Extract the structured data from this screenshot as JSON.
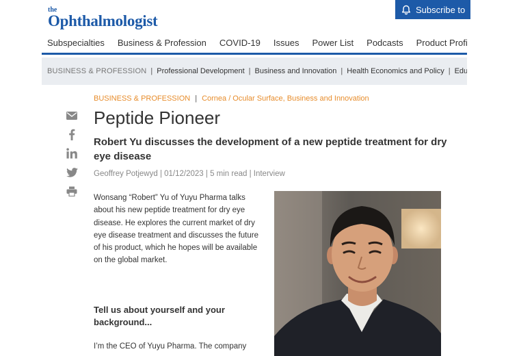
{
  "header": {
    "logo_the": "the",
    "logo_name": "Ophthalmologist",
    "subscribe_label": "Subscribe to"
  },
  "main_nav": {
    "items": [
      "Subspecialties",
      "Business & Profession",
      "COVID-19",
      "Issues",
      "Power List",
      "Podcasts",
      "Product Profile"
    ]
  },
  "sub_nav": {
    "section": "BUSINESS & PROFESSION",
    "separator": "|",
    "links": [
      "Professional Development",
      "Business and Innovation",
      "Health Economics and Policy",
      "Educa"
    ]
  },
  "share_icons": [
    "email-icon",
    "facebook-icon",
    "linkedin-icon",
    "twitter-icon",
    "print-icon"
  ],
  "article": {
    "category": "BUSINESS & PROFESSION",
    "category_separator": "|",
    "tags": "Cornea / Ocular Surface, Business and Innovation",
    "title": "Peptide Pioneer",
    "subtitle": "Robert Yu discusses the development of a new peptide treatment for dry eye disease",
    "meta": "Geoffrey Potjewyd | 01/12/2023 | 5 min read | Interview",
    "intro": "Wonsang “Robert” Yu of Yuyu Pharma talks about his new peptide treatment for dry eye disease. He explores the current market of dry eye disease treatment and discusses the future of his product, which he hopes will be available on the global market.",
    "question": "Tell us about yourself and your background...",
    "answer_start": "I’m the CEO of Yuyu Pharma. The company"
  },
  "colors": {
    "brand_blue": "#1d5aa8",
    "accent_orange": "#e78c2b",
    "subnav_bg": "#eaedf1"
  }
}
